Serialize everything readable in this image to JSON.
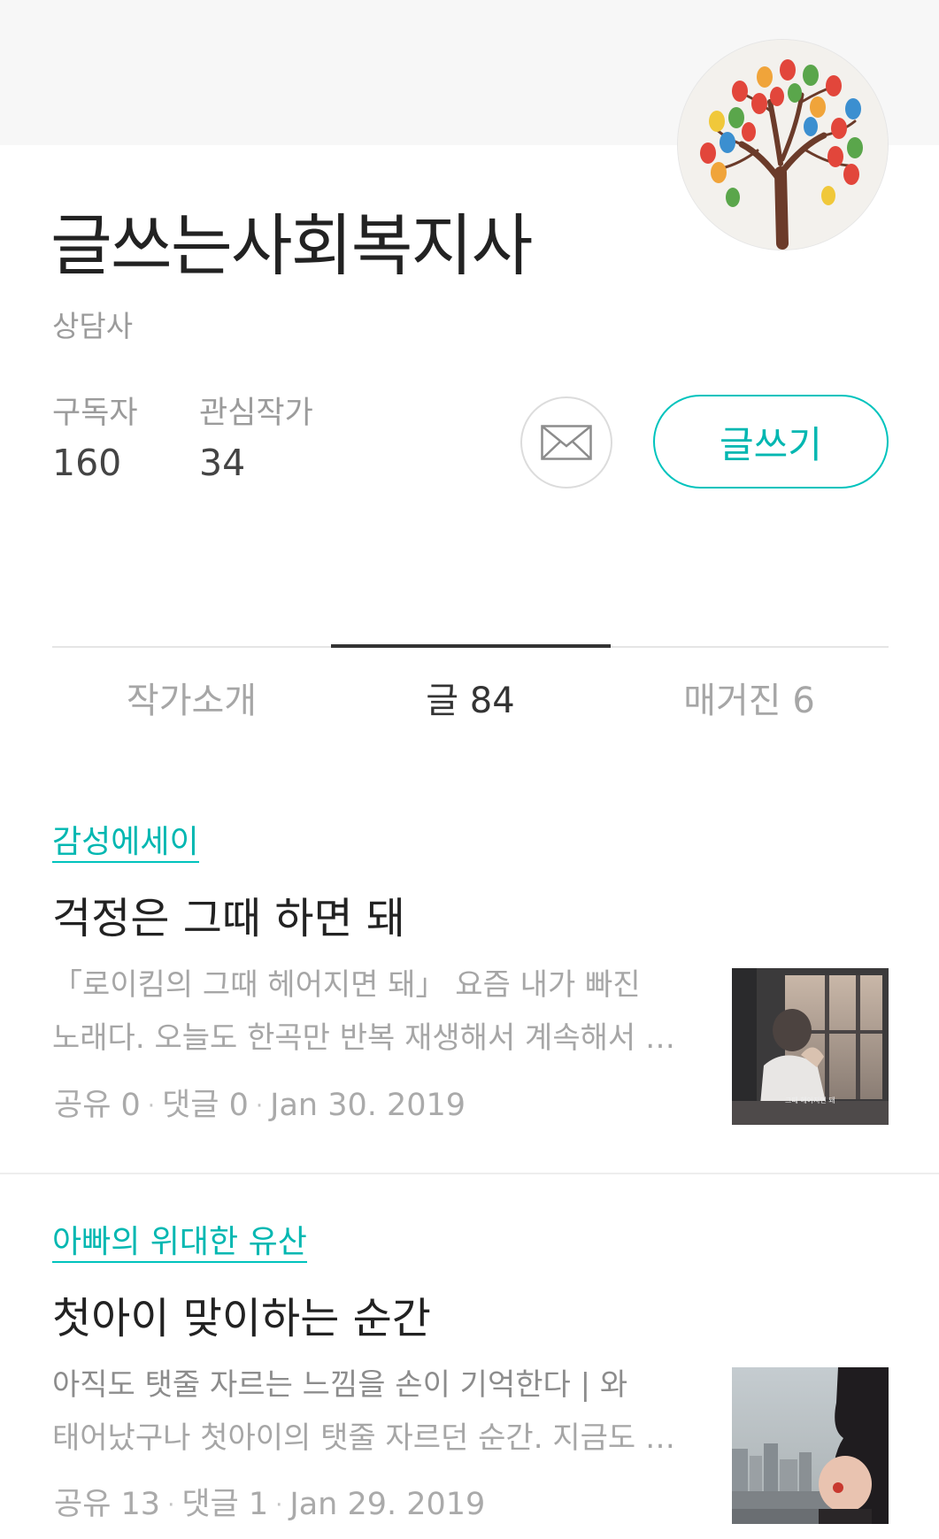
{
  "profile": {
    "name": "글쓰는사회복지사",
    "role": "상담사",
    "subscribers_label": "구독자",
    "subscribers_count": "160",
    "following_label": "관심작가",
    "following_count": "34",
    "write_button_label": "글쓰기",
    "avatar_icon": "tree-fingerprint-avatar"
  },
  "tabs": [
    {
      "label": "작가소개",
      "active": false
    },
    {
      "label": "글 84",
      "active": true
    },
    {
      "label": "매거진 6",
      "active": false
    }
  ],
  "articles": [
    {
      "category": "감성에세이",
      "title": "걱정은 그때 하면 돼",
      "excerpt_line1": "「로이킴의 그때 헤어지면 돼」 요즘 내가 빠진",
      "excerpt_line2": "노래다. 오늘도 한곡만 반복 재생해서 계속해서 …",
      "shares": "공유 0",
      "comments": "댓글 0",
      "date": "Jan 30. 2019",
      "thumb_caption": "그때 헤어지면 돼"
    },
    {
      "category": "아빠의 위대한 유산",
      "title": "첫아이 맞이하는 순간",
      "excerpt_line1": "아직도 탯줄 자르는 느낌을 손이 기억한다 |   와",
      "excerpt_line2": "태어났구나    첫아이의 탯줄 자르던 순간. 지금도 …",
      "shares": "공유 13",
      "comments": "댓글 1",
      "date": "Jan 29. 2019"
    }
  ],
  "colors": {
    "accent": "#00c3bd",
    "header_band": "#f7f7f7",
    "muted_text": "#a6a6a6"
  }
}
